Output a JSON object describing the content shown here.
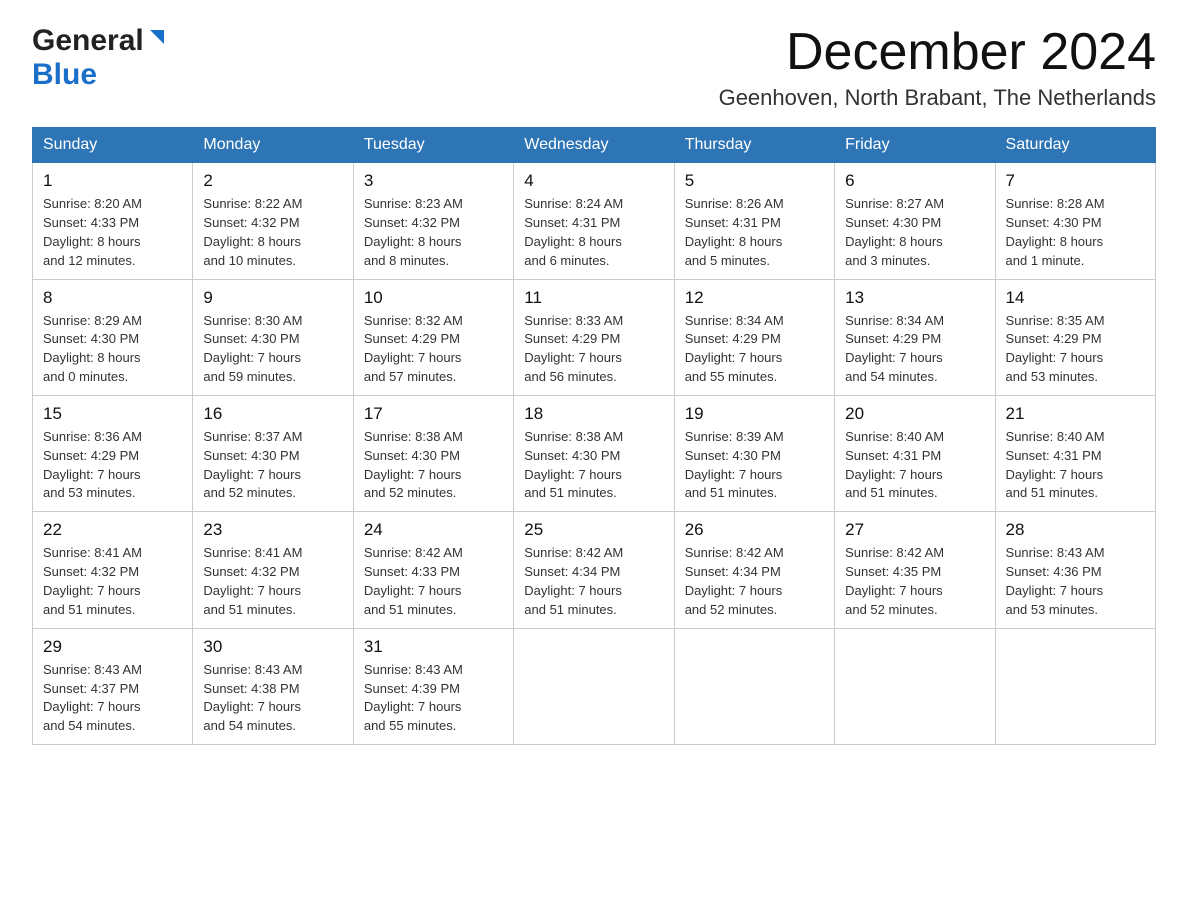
{
  "logo": {
    "general": "General",
    "blue": "Blue"
  },
  "title": "December 2024",
  "subtitle": "Geenhoven, North Brabant, The Netherlands",
  "headers": [
    "Sunday",
    "Monday",
    "Tuesday",
    "Wednesday",
    "Thursday",
    "Friday",
    "Saturday"
  ],
  "weeks": [
    [
      {
        "day": "1",
        "info": "Sunrise: 8:20 AM\nSunset: 4:33 PM\nDaylight: 8 hours\nand 12 minutes."
      },
      {
        "day": "2",
        "info": "Sunrise: 8:22 AM\nSunset: 4:32 PM\nDaylight: 8 hours\nand 10 minutes."
      },
      {
        "day": "3",
        "info": "Sunrise: 8:23 AM\nSunset: 4:32 PM\nDaylight: 8 hours\nand 8 minutes."
      },
      {
        "day": "4",
        "info": "Sunrise: 8:24 AM\nSunset: 4:31 PM\nDaylight: 8 hours\nand 6 minutes."
      },
      {
        "day": "5",
        "info": "Sunrise: 8:26 AM\nSunset: 4:31 PM\nDaylight: 8 hours\nand 5 minutes."
      },
      {
        "day": "6",
        "info": "Sunrise: 8:27 AM\nSunset: 4:30 PM\nDaylight: 8 hours\nand 3 minutes."
      },
      {
        "day": "7",
        "info": "Sunrise: 8:28 AM\nSunset: 4:30 PM\nDaylight: 8 hours\nand 1 minute."
      }
    ],
    [
      {
        "day": "8",
        "info": "Sunrise: 8:29 AM\nSunset: 4:30 PM\nDaylight: 8 hours\nand 0 minutes."
      },
      {
        "day": "9",
        "info": "Sunrise: 8:30 AM\nSunset: 4:30 PM\nDaylight: 7 hours\nand 59 minutes."
      },
      {
        "day": "10",
        "info": "Sunrise: 8:32 AM\nSunset: 4:29 PM\nDaylight: 7 hours\nand 57 minutes."
      },
      {
        "day": "11",
        "info": "Sunrise: 8:33 AM\nSunset: 4:29 PM\nDaylight: 7 hours\nand 56 minutes."
      },
      {
        "day": "12",
        "info": "Sunrise: 8:34 AM\nSunset: 4:29 PM\nDaylight: 7 hours\nand 55 minutes."
      },
      {
        "day": "13",
        "info": "Sunrise: 8:34 AM\nSunset: 4:29 PM\nDaylight: 7 hours\nand 54 minutes."
      },
      {
        "day": "14",
        "info": "Sunrise: 8:35 AM\nSunset: 4:29 PM\nDaylight: 7 hours\nand 53 minutes."
      }
    ],
    [
      {
        "day": "15",
        "info": "Sunrise: 8:36 AM\nSunset: 4:29 PM\nDaylight: 7 hours\nand 53 minutes."
      },
      {
        "day": "16",
        "info": "Sunrise: 8:37 AM\nSunset: 4:30 PM\nDaylight: 7 hours\nand 52 minutes."
      },
      {
        "day": "17",
        "info": "Sunrise: 8:38 AM\nSunset: 4:30 PM\nDaylight: 7 hours\nand 52 minutes."
      },
      {
        "day": "18",
        "info": "Sunrise: 8:38 AM\nSunset: 4:30 PM\nDaylight: 7 hours\nand 51 minutes."
      },
      {
        "day": "19",
        "info": "Sunrise: 8:39 AM\nSunset: 4:30 PM\nDaylight: 7 hours\nand 51 minutes."
      },
      {
        "day": "20",
        "info": "Sunrise: 8:40 AM\nSunset: 4:31 PM\nDaylight: 7 hours\nand 51 minutes."
      },
      {
        "day": "21",
        "info": "Sunrise: 8:40 AM\nSunset: 4:31 PM\nDaylight: 7 hours\nand 51 minutes."
      }
    ],
    [
      {
        "day": "22",
        "info": "Sunrise: 8:41 AM\nSunset: 4:32 PM\nDaylight: 7 hours\nand 51 minutes."
      },
      {
        "day": "23",
        "info": "Sunrise: 8:41 AM\nSunset: 4:32 PM\nDaylight: 7 hours\nand 51 minutes."
      },
      {
        "day": "24",
        "info": "Sunrise: 8:42 AM\nSunset: 4:33 PM\nDaylight: 7 hours\nand 51 minutes."
      },
      {
        "day": "25",
        "info": "Sunrise: 8:42 AM\nSunset: 4:34 PM\nDaylight: 7 hours\nand 51 minutes."
      },
      {
        "day": "26",
        "info": "Sunrise: 8:42 AM\nSunset: 4:34 PM\nDaylight: 7 hours\nand 52 minutes."
      },
      {
        "day": "27",
        "info": "Sunrise: 8:42 AM\nSunset: 4:35 PM\nDaylight: 7 hours\nand 52 minutes."
      },
      {
        "day": "28",
        "info": "Sunrise: 8:43 AM\nSunset: 4:36 PM\nDaylight: 7 hours\nand 53 minutes."
      }
    ],
    [
      {
        "day": "29",
        "info": "Sunrise: 8:43 AM\nSunset: 4:37 PM\nDaylight: 7 hours\nand 54 minutes."
      },
      {
        "day": "30",
        "info": "Sunrise: 8:43 AM\nSunset: 4:38 PM\nDaylight: 7 hours\nand 54 minutes."
      },
      {
        "day": "31",
        "info": "Sunrise: 8:43 AM\nSunset: 4:39 PM\nDaylight: 7 hours\nand 55 minutes."
      },
      {
        "day": "",
        "info": ""
      },
      {
        "day": "",
        "info": ""
      },
      {
        "day": "",
        "info": ""
      },
      {
        "day": "",
        "info": ""
      }
    ]
  ]
}
